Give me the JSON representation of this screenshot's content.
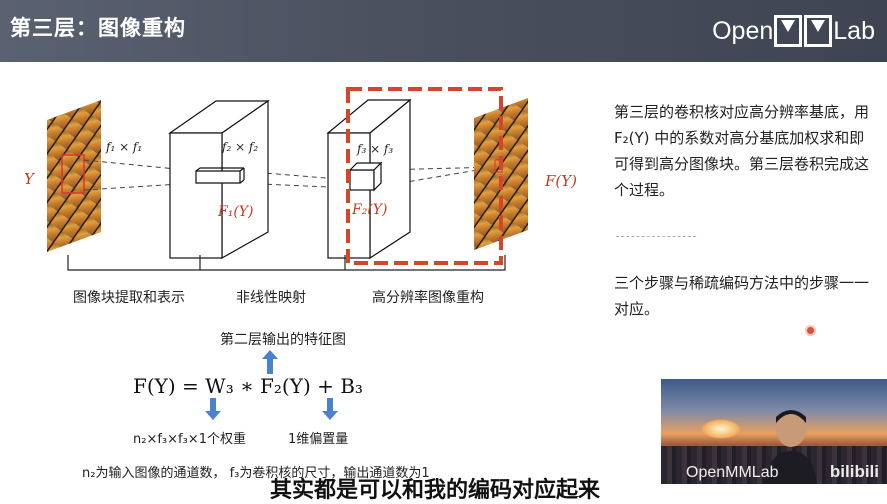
{
  "header": {
    "title": "第三层：图像重构",
    "brand_left": "Open",
    "brand_right": "Lab"
  },
  "diagram": {
    "input_label": "Y",
    "output_label": "F(Y)",
    "kernel1": "f₁ × f₁",
    "kernel2": "f₂ × f₂",
    "kernel3": "f₃ × f₃",
    "map1": "F₁(Y)",
    "map2": "F₂(Y)",
    "step1": "图像块提取和表示",
    "step2": "非线性映射",
    "step3": "高分辨率图像重构",
    "highlight_color": "#d4452a"
  },
  "right_panel": {
    "para1": "第三层的卷积核对应高分辨率基底，用 F₂(Y) 中的系数对高分基底加权求和即可得到高分图像块。第三层卷积完成这个过程。",
    "para2": "三个步骤与稀疏编码方法中的步骤一一对应。"
  },
  "formula": {
    "above_label": "第二层输出的特征图",
    "equation": "F(Y) = W₃ ∗ F₂(Y) + B₃",
    "below_left": "n₂×f₃×f₃×1个权重",
    "below_right": "1维偏置量",
    "note": "n₂为输入图像的通道数， f₃为卷积核的尺寸，输出通道数为1"
  },
  "webcam": {
    "watermark": "OpenMMLab",
    "site": "bilibili"
  },
  "subtitle": "其实都是可以和我的编码对应起来"
}
